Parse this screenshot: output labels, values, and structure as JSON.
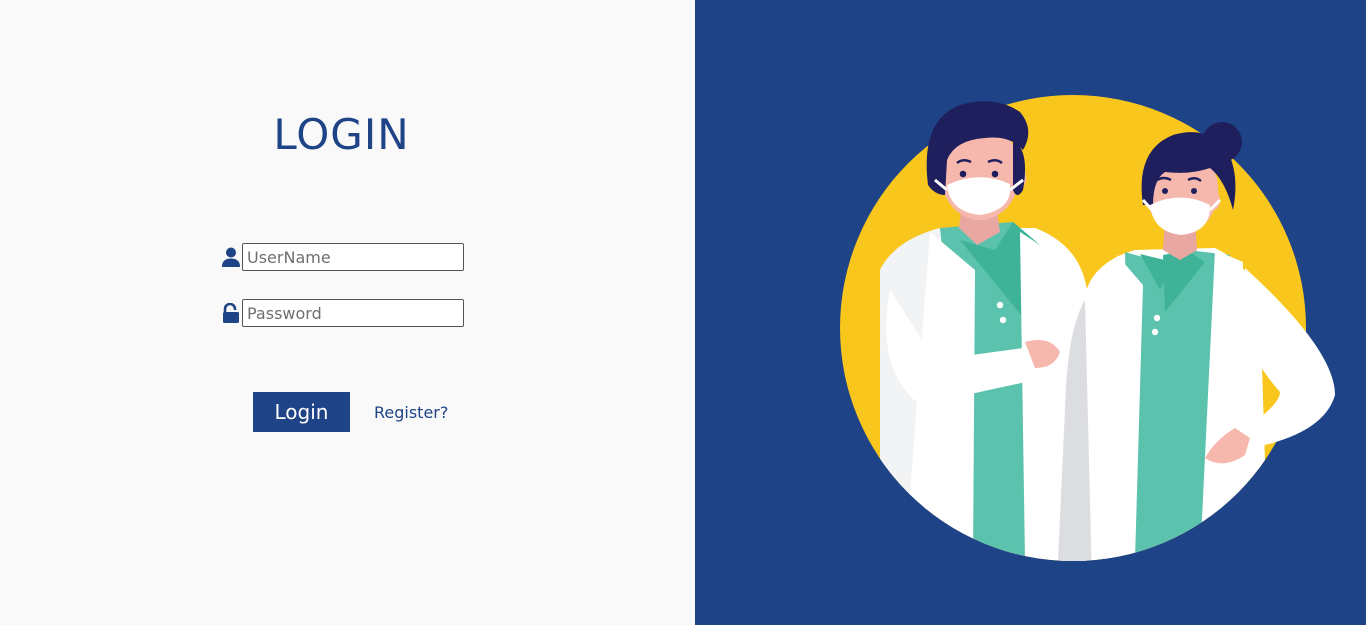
{
  "login_form": {
    "title": "LOGIN",
    "username_placeholder": "UserName",
    "password_placeholder": "Password",
    "username_icon": "user-icon",
    "password_icon": "unlock-icon",
    "login_button_label": "Login",
    "register_link_label": "Register?"
  },
  "illustration": {
    "subject": "two-doctors-in-masks"
  },
  "colors": {
    "brand_blue": "#1e4487",
    "left_background": "#f9f9f9",
    "circle_yellow": "#f8c61c",
    "scrub_green": "#5bc2ad"
  }
}
